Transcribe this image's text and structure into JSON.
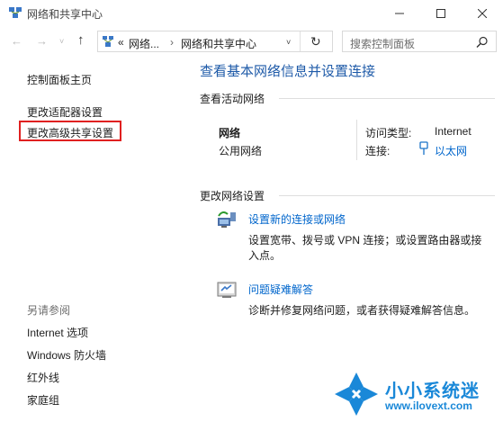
{
  "window": {
    "title": "网络和共享中心",
    "minimize_icon": "minimize-icon",
    "maximize_icon": "maximize-icon",
    "close_icon": "close-icon"
  },
  "address_bar": {
    "crumb_overflow": "«",
    "crumbs": [
      "网络...",
      "网络和共享中心"
    ],
    "search_placeholder": "搜索控制面板"
  },
  "sidebar": {
    "links": [
      "控制面板主页",
      "更改适配器设置",
      "更改高级共享设置"
    ],
    "highlighted_index": 2,
    "see_also_label": "另请参阅",
    "see_also": [
      "Internet 选项",
      "Windows 防火墙",
      "红外线",
      "家庭组"
    ]
  },
  "main": {
    "heading": "查看基本网络信息并设置连接",
    "active_networks_label": "查看活动网络",
    "network_name": "网络",
    "network_type": "公用网络",
    "access_type_label": "访问类型:",
    "access_type_value": "Internet",
    "connection_label": "连接:",
    "connection_value": "以太网",
    "change_settings_label": "更改网络设置",
    "tasks": [
      {
        "title": "设置新的连接或网络",
        "desc_line1": "设置宽带、拨号或 VPN 连接；或设置路由器或接",
        "desc_line2": "入点。"
      },
      {
        "title": "问题疑难解答",
        "desc_line1": "诊断并修复网络问题，或者获得疑难解答信息。"
      }
    ]
  },
  "watermark": {
    "brand": "小小系统迷",
    "url": "www.ilovext.com"
  },
  "colors": {
    "accent": "#1e5aa8",
    "link": "#0066cc",
    "highlight_border": "#e02020",
    "watermark_blue": "#1a88d8"
  }
}
